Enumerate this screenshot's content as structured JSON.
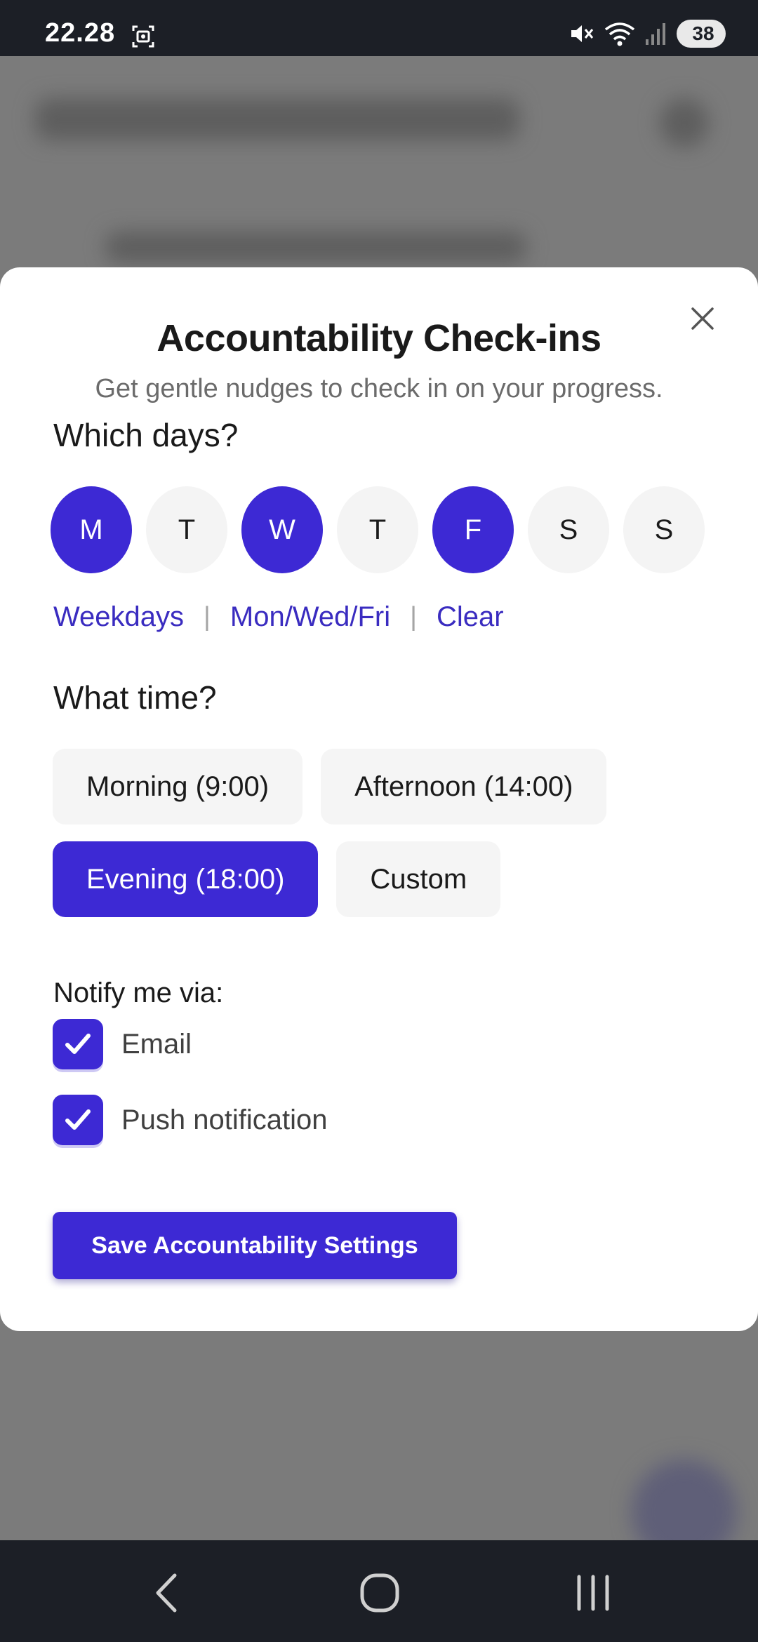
{
  "status_bar": {
    "time": "22.28",
    "battery": "38"
  },
  "modal": {
    "title": "Accountability Check-ins",
    "subtitle": "Get gentle nudges to check in on your progress.",
    "days_heading": "Which days?",
    "days": [
      {
        "label": "M",
        "selected": true
      },
      {
        "label": "T",
        "selected": false
      },
      {
        "label": "W",
        "selected": true
      },
      {
        "label": "T",
        "selected": false
      },
      {
        "label": "F",
        "selected": true
      },
      {
        "label": "S",
        "selected": false
      },
      {
        "label": "S",
        "selected": false
      }
    ],
    "presets": {
      "weekdays": "Weekdays",
      "mon_wed_fri": "Mon/Wed/Fri",
      "clear": "Clear",
      "separator": "|"
    },
    "time_heading": "What time?",
    "time_options": [
      {
        "label": "Morning (9:00)",
        "selected": false
      },
      {
        "label": "Afternoon (14:00)",
        "selected": false
      },
      {
        "label": "Evening (18:00)",
        "selected": true
      },
      {
        "label": "Custom",
        "selected": false
      }
    ],
    "notify_heading": "Notify me via:",
    "notify_options": [
      {
        "label": "Email",
        "checked": true
      },
      {
        "label": "Push notification",
        "checked": true
      }
    ],
    "save_label": "Save Accountability Settings"
  },
  "colors": {
    "accent": "#3d29d4",
    "link": "#3a2cc0",
    "chip_bg": "#f5f5f5"
  },
  "icons": {
    "close": "close-icon",
    "check": "checkmark-icon",
    "back": "back-chevron-icon",
    "home": "home-circle-icon",
    "recents": "recents-bars-icon"
  }
}
